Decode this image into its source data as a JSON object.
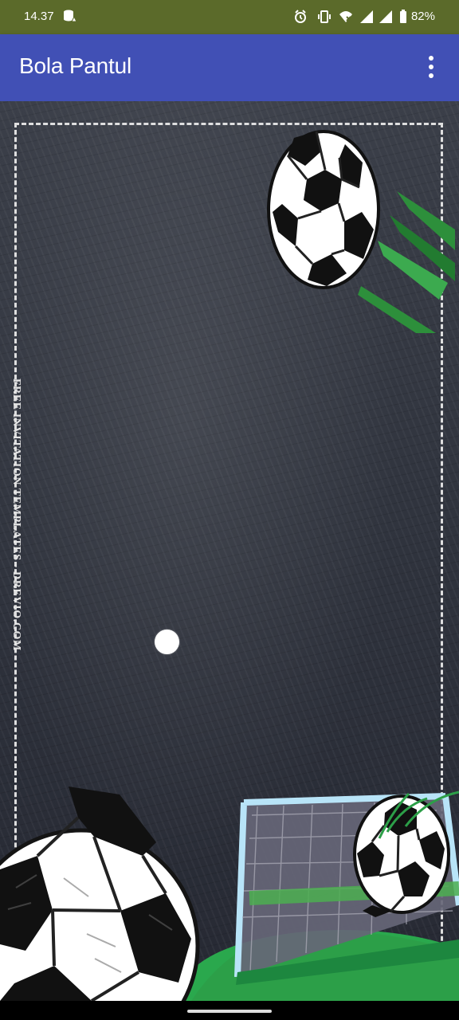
{
  "status_bar": {
    "time": "14.37",
    "battery": "82%",
    "icons": [
      "database-warning-icon",
      "alarm-icon",
      "vibrate-icon",
      "wifi-icon",
      "signal-1-icon",
      "signal-2-icon",
      "battery-icon"
    ]
  },
  "app_bar": {
    "title": "Bola Pantul",
    "menu_icon": "overflow-menu-icon"
  },
  "game": {
    "watermark": "FREE INVITATION TEMPLATES - DREVIO.COM",
    "ball": "white-circle-ball"
  },
  "colors": {
    "status_bar": "#5b6a2a",
    "app_bar": "#4150b5",
    "chalkboard": "#30343e",
    "grass": "#2ea44f",
    "goal_frame": "#9fd5f1"
  }
}
